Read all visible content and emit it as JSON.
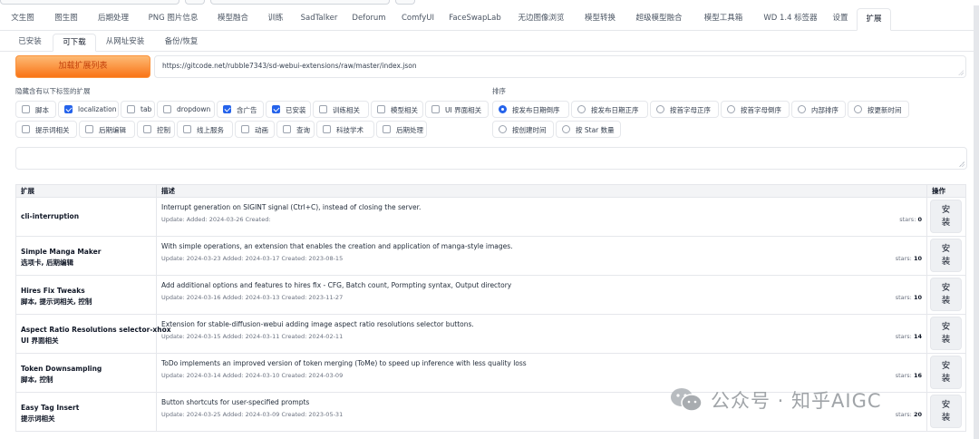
{
  "main_tabs": [
    "文生图",
    "图生图",
    "后期处理",
    "PNG 图片信息",
    "模型融合",
    "训练",
    "SadTalker",
    "Deforum",
    "ComfyUI",
    "FaceSwapLab",
    "无边图像浏览",
    "模型转换",
    "超级模型融合",
    "模型工具箱",
    "WD 1.4 标签器",
    "设置",
    "扩展"
  ],
  "sub_tabs": [
    "已安装",
    "可下载",
    "从网址安装",
    "备份/恢复"
  ],
  "load_button": "加载扩展列表",
  "index_url": "https://gitcode.net/rubble7343/sd-webui-extensions/raw/master/index.json",
  "hide_label": "隐藏含有以下标签的扩展",
  "hide_tags": [
    {
      "label": "脚本",
      "checked": false
    },
    {
      "label": "localization",
      "checked": true
    },
    {
      "label": "tab",
      "checked": false
    },
    {
      "label": "dropdown",
      "checked": false
    },
    {
      "label": "含广告",
      "checked": true
    },
    {
      "label": "已安装",
      "checked": true
    },
    {
      "label": "训练相关",
      "checked": false
    },
    {
      "label": "模型相关",
      "checked": false
    },
    {
      "label": "UI 界面相关",
      "checked": false
    },
    {
      "label": "提示词相关",
      "checked": false
    },
    {
      "label": "后期编辑",
      "checked": false
    },
    {
      "label": "控制",
      "checked": false
    },
    {
      "label": "线上服务",
      "checked": false
    },
    {
      "label": "动画",
      "checked": false
    },
    {
      "label": "查询",
      "checked": false
    },
    {
      "label": "科技学术",
      "checked": false
    },
    {
      "label": "后期处理",
      "checked": false
    }
  ],
  "sort_label": "排序",
  "sort_options": [
    {
      "label": "按发布日期倒序",
      "selected": true
    },
    {
      "label": "按发布日期正序",
      "selected": false
    },
    {
      "label": "按首字母正序",
      "selected": false
    },
    {
      "label": "按首字母倒序",
      "selected": false
    },
    {
      "label": "内部排序",
      "selected": false
    },
    {
      "label": "按更新时间",
      "selected": false
    },
    {
      "label": "按创建时间",
      "selected": false
    },
    {
      "label": "按 Star 数量",
      "selected": false
    }
  ],
  "table": {
    "headers": [
      "扩展",
      "描述",
      "操作"
    ],
    "rows": [
      {
        "name": "cli-interruption",
        "tags": "",
        "desc": "Interrupt generation on SIGINT signal (Ctrl+C), instead of closing the server.",
        "info": "Update: Added: 2024-03-26 Created:",
        "stars_label": "stars:",
        "stars": "0",
        "button": "安装"
      },
      {
        "name": "Simple Manga Maker",
        "tags": "选项卡, 后期编辑",
        "desc": "With simple operations, an extension that enables the creation and application of manga-style images.",
        "info": "Update: 2024-03-23 Added: 2024-03-17 Created: 2023-08-15",
        "stars_label": "stars:",
        "stars": "10",
        "button": "安装"
      },
      {
        "name": "Hires Fix Tweaks",
        "tags": "脚本, 提示词相关, 控制",
        "desc": "Add additional options and features to hires fix - CFG, Batch count, Pormpting syntax, Output directory",
        "info": "Update: 2024-03-16 Added: 2024-03-13 Created: 2023-11-27",
        "stars_label": "stars:",
        "stars": "10",
        "button": "安装"
      },
      {
        "name": "Aspect Ratio Resolutions selector-xhox",
        "tags": "UI 界面相关",
        "desc": "Extension for stable-diffusion-webui adding image aspect ratio resolutions selector buttons.",
        "info": "Update: 2024-03-15 Added: 2024-03-11 Created: 2024-02-11",
        "stars_label": "stars:",
        "stars": "14",
        "button": "安装"
      },
      {
        "name": "Token Downsampling",
        "tags": "脚本, 控制",
        "desc": "ToDo implements an improved version of token merging (ToMe) to speed up inference with less quality loss",
        "info": "Update: 2024-03-14 Added: 2024-03-10 Created: 2024-03-09",
        "stars_label": "stars:",
        "stars": "16",
        "button": "安装"
      },
      {
        "name": "Easy Tag Insert",
        "tags": "提示词相关",
        "desc": "Button shortcuts for user-specified prompts",
        "info": "Update: 2024-03-25 Added: 2024-03-09 Created: 2023-05-31",
        "stars_label": "stars:",
        "stars": "20",
        "button": "安装"
      }
    ]
  },
  "watermark": "公众号 · 知乎AIGC",
  "colors": {
    "accent": "#f97316",
    "checked": "#2563eb"
  }
}
